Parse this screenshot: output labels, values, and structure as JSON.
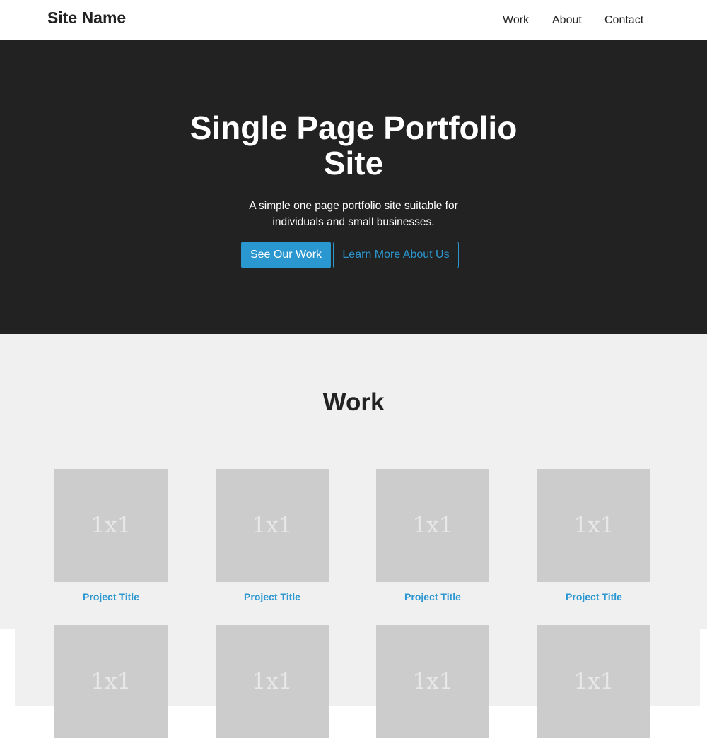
{
  "header": {
    "site_name": "Site Name",
    "nav": {
      "work": "Work",
      "about": "About",
      "contact": "Contact"
    }
  },
  "hero": {
    "title": "Single Page Portfolio Site",
    "subtitle": "A simple one page portfolio site suitable for individuals and small businesses.",
    "primary_button": "See Our Work",
    "secondary_button": "Learn More About Us"
  },
  "work": {
    "heading": "Work",
    "projects": [
      {
        "thumb_label": "1x1",
        "title": "Project Title"
      },
      {
        "thumb_label": "1x1",
        "title": "Project Title"
      },
      {
        "thumb_label": "1x1",
        "title": "Project Title"
      },
      {
        "thumb_label": "1x1",
        "title": "Project Title"
      },
      {
        "thumb_label": "1x1",
        "title": ""
      },
      {
        "thumb_label": "1x1",
        "title": ""
      },
      {
        "thumb_label": "1x1",
        "title": ""
      },
      {
        "thumb_label": "1x1",
        "title": ""
      }
    ]
  },
  "colors": {
    "accent": "#2b97d0",
    "hero_background": "#222222",
    "section_background": "#f0f0f0",
    "thumbnail_placeholder": "#cccccc"
  }
}
